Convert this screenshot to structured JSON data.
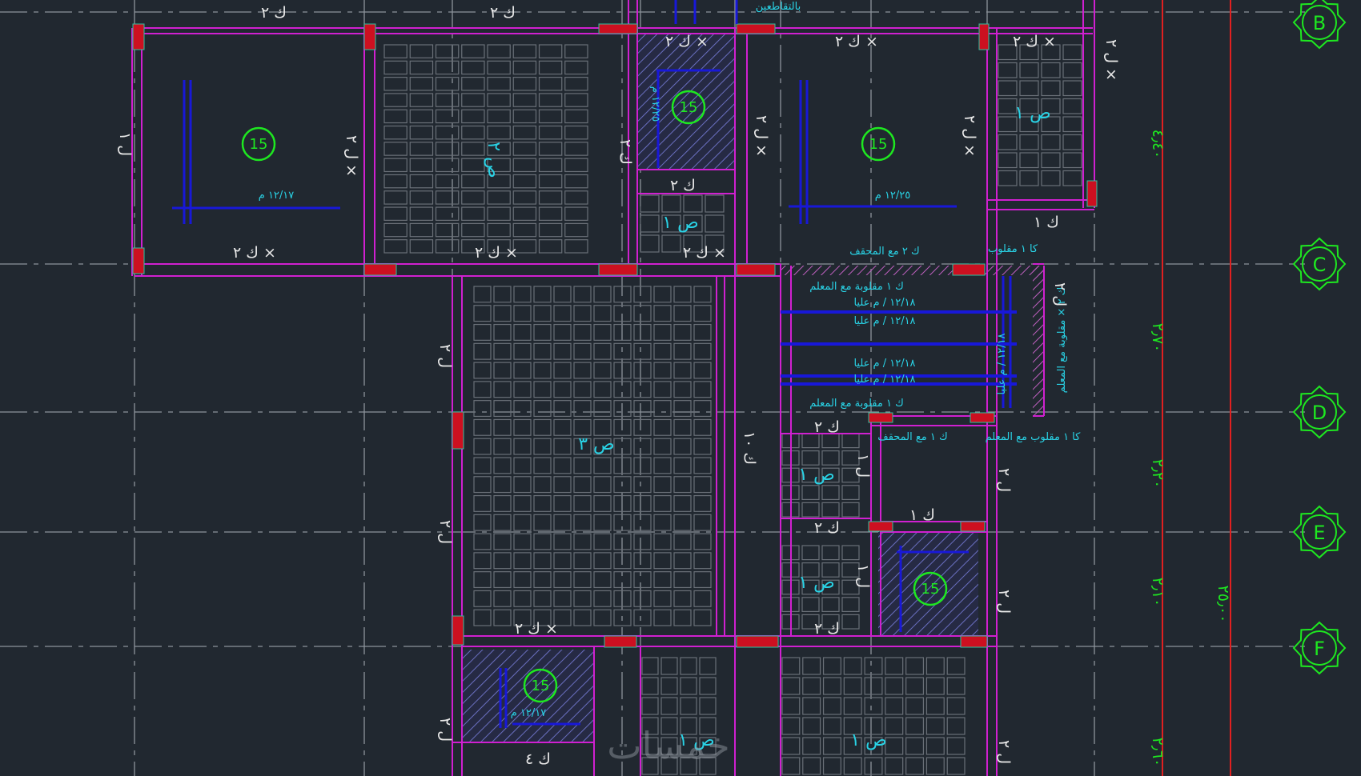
{
  "watermark": "خمسات",
  "grid_bubbles": [
    "B",
    "C",
    "D",
    "E",
    "F"
  ],
  "dimensions": [
    "٤٫٤٠",
    "٢٫٧٠",
    "٢٫٢٠",
    "٢٫١٠",
    "٢٫٦٠",
    "٢٥٫٠٠"
  ],
  "slab_thickness": "15",
  "labels": [
    "ك ٢",
    "ك ٢",
    "ك ٢ ×",
    "ك ٢ ×",
    "ك ٢ ×",
    "ك ٢ ×",
    "ك ٢ ×",
    "ك ٢ ×",
    "ك ٢ ×",
    "ك ٢",
    "ك ٢",
    "ك ٢",
    "ك ٢",
    "ك ١",
    "ك ١",
    "ك ٤",
    "ك ٢ مع المحقف",
    "ك ١ مع المحقف",
    "ك ١ مقلوبة مع المعلم",
    "ك ١ مقلوبة مع المعلم",
    "كا ١ مقلوب",
    "كا ١ مقلوب مع المعلم",
    "ك ٢ × مقلوبة مع المعلم",
    "ل ١",
    "ل ٢ ×",
    "ل ٢ ×",
    "ل ٢ ×",
    "ل ٢ ×",
    "ل ٢",
    "ل ٢",
    "ل ٢",
    "ل ٢",
    "ل ٢",
    "ل ٢",
    "ل ٢",
    "ل ١",
    "ل ١",
    "ك ٢",
    "ك ١٠",
    "ص ٢",
    "ص ١",
    "ص ١",
    "ص ٣",
    "ص ١",
    "ص ١",
    "ص ١",
    "ص ١",
    "١٢/٢٥ م",
    "١٢/١٧ م",
    "١٢/٢٥ م",
    "١٢/١٧ م",
    "١٢/١٨ / م عليا",
    "١٢/١٨ / م عليا",
    "١٢/١٨ / م عليا",
    "١٢/١٨ / م عليا",
    "١٢/١٨ / م عليا",
    "بالتقاطعين"
  ]
}
